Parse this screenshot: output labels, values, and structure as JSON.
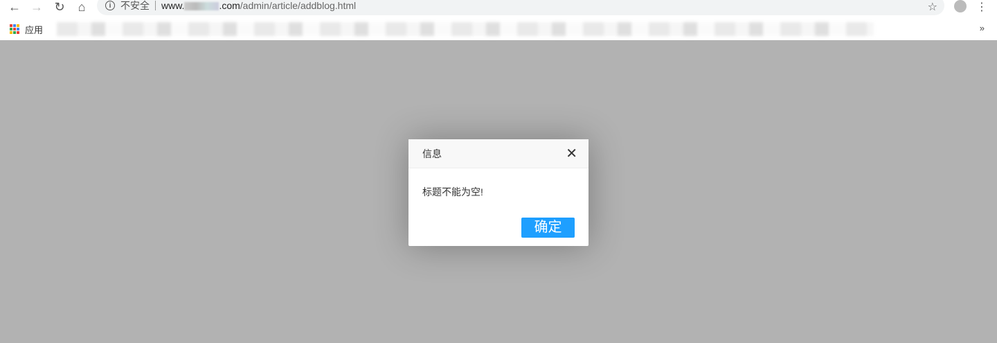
{
  "browser": {
    "security_label": "不安全",
    "url_host_prefix": "www.",
    "url_host_suffix": ".com",
    "url_path": "/admin/article/addblog.html",
    "apps_label": "应用",
    "more_label": "»"
  },
  "dialog": {
    "title": "信息",
    "message": "标题不能为空!",
    "confirm_label": "确定",
    "accent_color": "#1e9fff"
  }
}
